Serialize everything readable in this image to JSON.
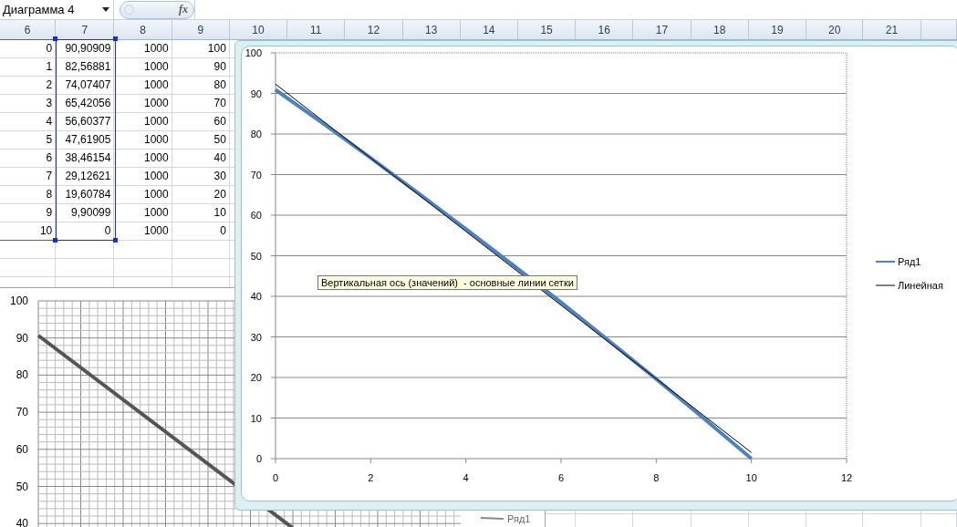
{
  "toolbar": {
    "name_box": "Диаграмма 4",
    "formula_button": "fx"
  },
  "sheet": {
    "columns": [
      {
        "label": "6",
        "color": "#9b30c8"
      },
      {
        "label": "7",
        "color": "#1c2bd0"
      },
      {
        "label": "8"
      },
      {
        "label": "9"
      },
      {
        "label": "10"
      },
      {
        "label": "11"
      },
      {
        "label": "12"
      },
      {
        "label": "13"
      },
      {
        "label": "14"
      },
      {
        "label": "15"
      },
      {
        "label": "16"
      },
      {
        "label": "17"
      },
      {
        "label": "18"
      },
      {
        "label": "19"
      },
      {
        "label": "20"
      },
      {
        "label": "21"
      }
    ],
    "rows": [
      {
        "cells": [
          "0",
          "90,90909",
          "1000",
          "100"
        ]
      },
      {
        "cells": [
          "1",
          "82,56881",
          "1000",
          "90"
        ]
      },
      {
        "cells": [
          "2",
          "74,07407",
          "1000",
          "80"
        ]
      },
      {
        "cells": [
          "3",
          "65,42056",
          "1000",
          "70"
        ]
      },
      {
        "cells": [
          "4",
          "56,60377",
          "1000",
          "60"
        ]
      },
      {
        "cells": [
          "5",
          "47,61905",
          "1000",
          "50"
        ]
      },
      {
        "cells": [
          "6",
          "38,46154",
          "1000",
          "40"
        ]
      },
      {
        "cells": [
          "7",
          "29,12621",
          "1000",
          "30"
        ]
      },
      {
        "cells": [
          "8",
          "19,60784",
          "1000",
          "20"
        ]
      },
      {
        "cells": [
          "9",
          "9,90099",
          "1000",
          "10"
        ]
      },
      {
        "cells": [
          "10",
          "0",
          "1000",
          "0"
        ]
      }
    ]
  },
  "background_chart": {
    "y_tick_labels": [
      "100",
      "90",
      "80",
      "70",
      "60",
      "50",
      "40"
    ],
    "legend": "Ряд1"
  },
  "chart": {
    "tooltip": "Вертикальная ось (значений)  - основные линии сетки",
    "chart_data": {
      "type": "line",
      "x": [
        0,
        1,
        2,
        3,
        4,
        5,
        6,
        7,
        8,
        9,
        10
      ],
      "series": [
        {
          "name": "Ряд1",
          "color": "#4f81bd",
          "values": [
            90.9,
            82.6,
            74.1,
            65.4,
            56.6,
            47.6,
            38.5,
            29.1,
            19.6,
            9.9,
            0
          ]
        },
        {
          "name": "Линейная",
          "color": "#000000",
          "values": [
            92.3,
            83.2,
            74.1,
            65.1,
            56.0,
            46.9,
            37.8,
            28.7,
            19.7,
            10.6,
            1.5
          ]
        }
      ],
      "grid": "y",
      "legend": "right",
      "xlim": [
        0,
        12
      ],
      "ylim": [
        0,
        100
      ],
      "xticks": [
        0,
        2,
        4,
        6,
        8,
        10,
        12
      ],
      "yticks": [
        0,
        10,
        20,
        30,
        40,
        50,
        60,
        70,
        80,
        90,
        100
      ]
    }
  }
}
